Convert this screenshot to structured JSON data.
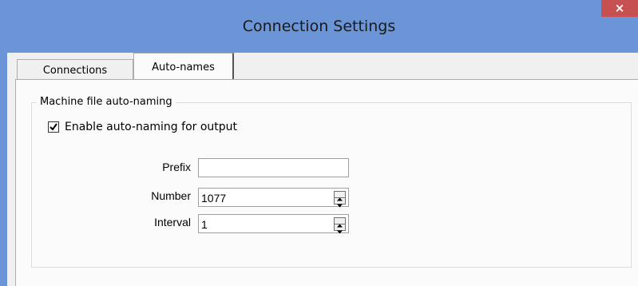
{
  "window": {
    "title": "Connection Settings",
    "close_label": "×"
  },
  "tabs": [
    {
      "label": "Connections",
      "active": false
    },
    {
      "label": "Auto-names",
      "active": true
    }
  ],
  "group": {
    "label": "Machine file auto-naming",
    "enable_checkbox": {
      "label": "Enable auto-naming for output",
      "checked": true
    },
    "fields": {
      "prefix": {
        "label": "Prefix",
        "value": ""
      },
      "number": {
        "label": "Number",
        "value": "1077"
      },
      "interval": {
        "label": "Interval",
        "value": "1"
      }
    }
  },
  "colors": {
    "titlebar": "#6b95d6",
    "close_button": "#c75050",
    "panel": "#fbfbfb",
    "client": "#f0f0f0"
  },
  "icons": {
    "checkbox": "check-icon",
    "spin_up": "triangle-up-icon",
    "spin_down": "triangle-down-icon"
  }
}
